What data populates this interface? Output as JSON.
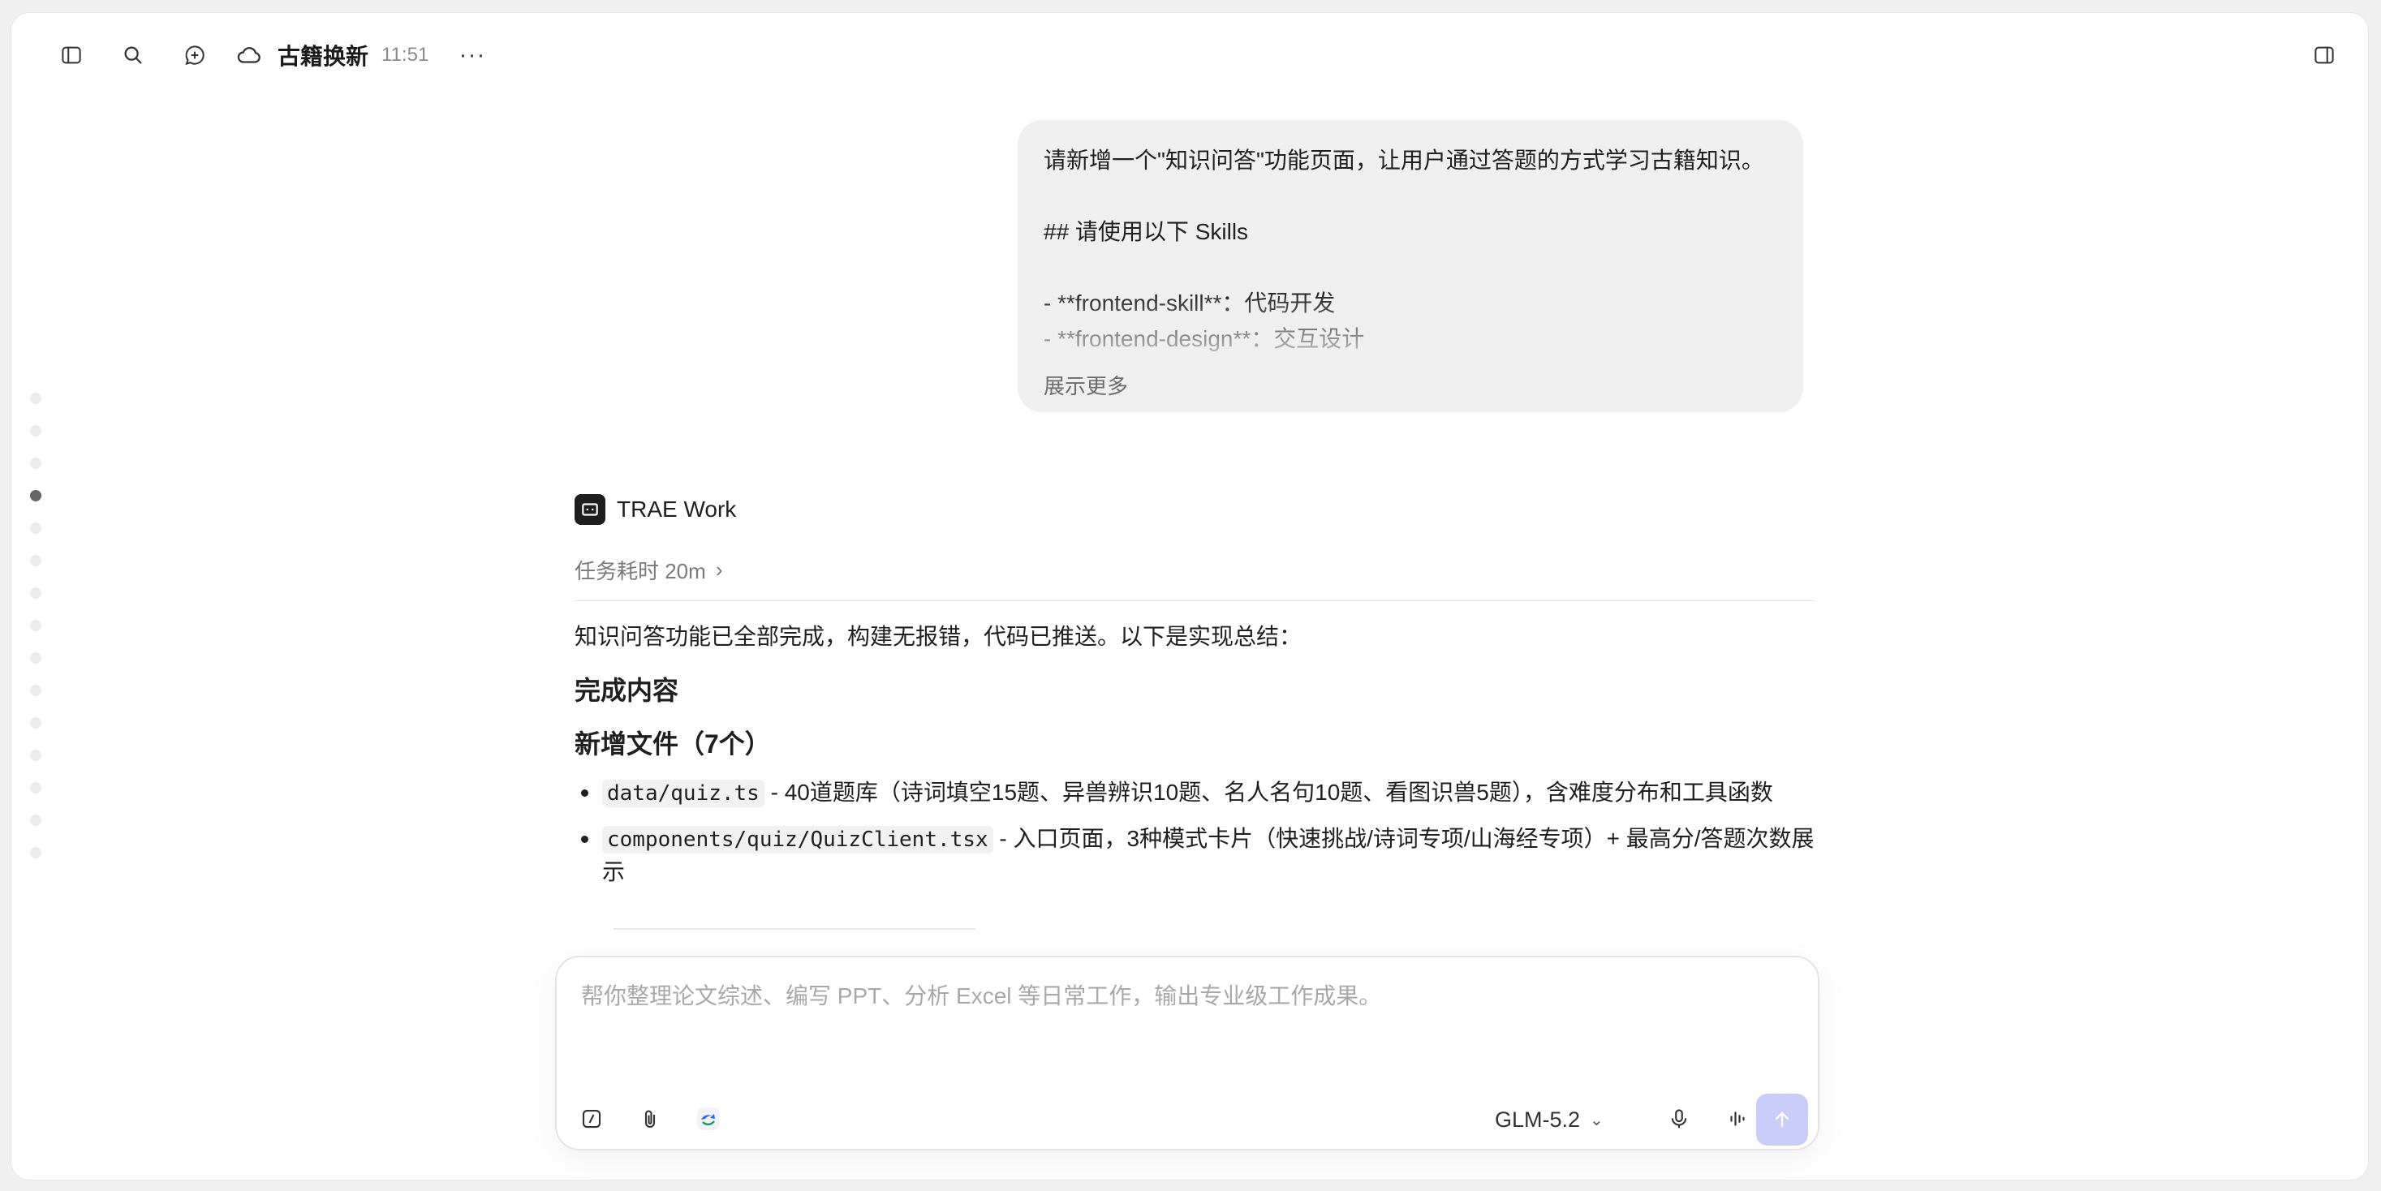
{
  "header": {
    "title": "古籍换新",
    "time": "11:51",
    "more": "···"
  },
  "user_message": {
    "lines": [
      "请新增一个\"知识问答\"功能页面，让用户通过答题的方式学习古籍知识。",
      "",
      "## 请使用以下 Skills",
      "",
      "- **frontend-skill**：代码开发",
      "- **frontend-design**：交互设计"
    ],
    "show_more": "展示更多"
  },
  "assistant": {
    "name": "TRAE Work",
    "task_time": "任务耗时 20m",
    "summary": "知识问答功能已全部完成，构建无报错，代码已推送。以下是实现总结：",
    "heading_done": "完成内容",
    "heading_files": "新增文件（7个）",
    "files": [
      {
        "code": "data/quiz.ts",
        "desc": " - 40道题库（诗词填空15题、异兽辨识10题、名人名句10题、看图识兽5题），含难度分布和工具函数"
      },
      {
        "code": "components/quiz/QuizClient.tsx",
        "desc": " - 入口页面，3种模式卡片（快速挑战/诗词专项/山海经专项）+ 最高分/答题次数展示"
      }
    ]
  },
  "composer": {
    "placeholder": "帮你整理论文综述、编写 PPT、分析 Excel 等日常工作，输出专业级工作成果。",
    "value": "",
    "model": "GLM-5.2"
  },
  "rail": {
    "count": 15,
    "active_index": 3
  },
  "colors": {
    "send_button": "#c9cdf7",
    "bubble": "#efefef"
  }
}
